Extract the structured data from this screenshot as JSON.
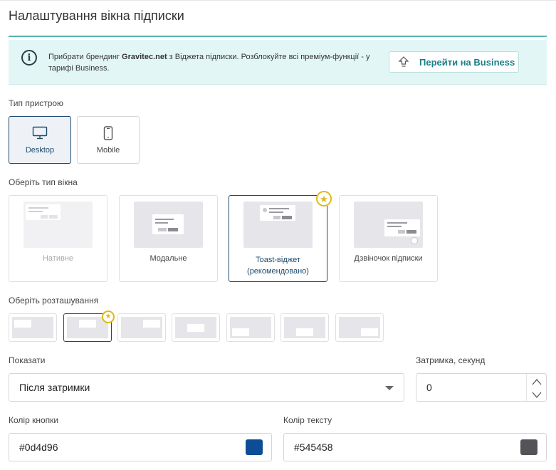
{
  "title": "Налаштування вікна підписки",
  "banner": {
    "text_before": "Прибрати брендинг ",
    "brand": "Gravitec.net",
    "text_after": " з Віджета підписки. Розблокуйте всі преміум-функції - у тарифі Business.",
    "button_label": "Перейти на Business",
    "accent_color": "#1a7f86",
    "background_color": "#e3f6f6"
  },
  "device": {
    "label": "Тип пристрою",
    "options": [
      {
        "label": "Desktop",
        "icon": "desktop-icon",
        "selected": true
      },
      {
        "label": "Mobile",
        "icon": "mobile-icon",
        "selected": false
      }
    ]
  },
  "window_type": {
    "label": "Оберіть тип вікна",
    "options": [
      {
        "label": "Нативне",
        "state": "disabled"
      },
      {
        "label": "Модальне",
        "state": "normal"
      },
      {
        "label": "Toast-віджет (рекомендовано)",
        "state": "selected",
        "recommended": true
      },
      {
        "label": "Дзвіночок підписки",
        "state": "normal"
      }
    ]
  },
  "position": {
    "label": "Оберіть розташування",
    "selected_index": 1,
    "recommended_index": 1,
    "count": 7
  },
  "show": {
    "label": "Показати",
    "value": "Після затримки"
  },
  "delay": {
    "label": "Затримка, секунд",
    "value": "0"
  },
  "button_color": {
    "label": "Колір кнопки",
    "value": "#0d4d96"
  },
  "text_color": {
    "label": "Колір тексту",
    "value": "#545458"
  }
}
